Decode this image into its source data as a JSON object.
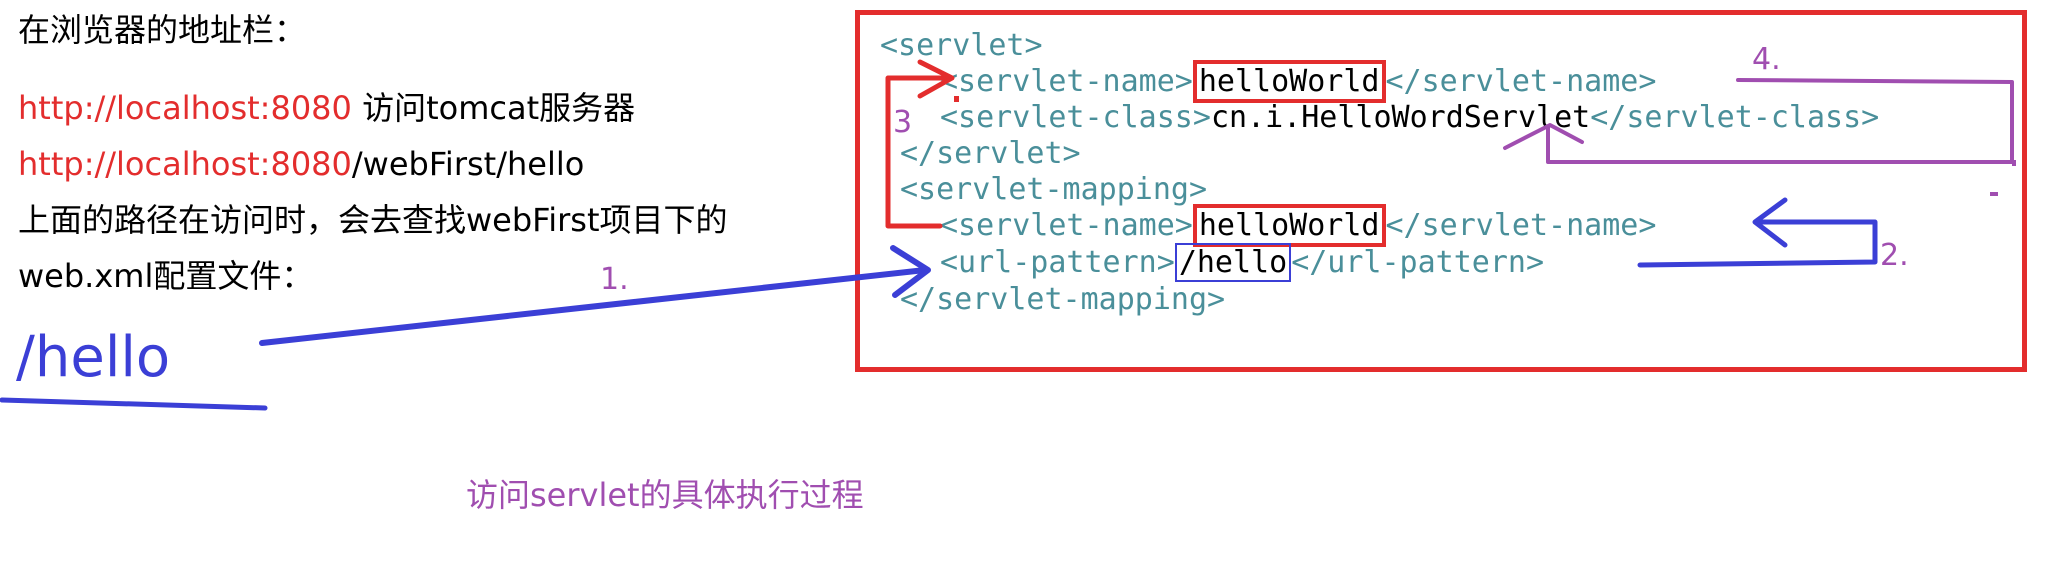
{
  "left": {
    "heading": "在浏览器的地址栏：",
    "line1_url": "http://localhost:8080",
    "line1_rest": " 访问tomcat服务器",
    "line2_url": "http://localhost:8080",
    "line2_rest": "/webFirst/hello",
    "line3": "上面的路径在访问时，会去查找webFirst项目下的",
    "line4": "web.xml配置文件：",
    "path": "/hello"
  },
  "caption": "访问servlet的具体执行过程",
  "code": {
    "l1": "<servlet>",
    "l2_open": "<servlet-name>",
    "l2_val": "helloWorld",
    "l2_close": "</servlet-name>",
    "l3_open": "<servlet-class>",
    "l3_val": "cn.i.HelloWordServlet",
    "l3_close": "</servlet-class>",
    "l4": "</servlet>",
    "l5": "<servlet-mapping>",
    "l6_open": "<servlet-name>",
    "l6_val": "helloWorld",
    "l6_close": "</servlet-name>",
    "l7_open": "<url-pattern>",
    "l7_val": "/hello",
    "l7_close": "</url-pattern>",
    "l8": "</servlet-mapping>"
  },
  "steps": {
    "s1": "1.",
    "s2": "2.",
    "s3": "3",
    "s4": "4."
  },
  "colors": {
    "red": "#e32d2d",
    "blue": "#3b3fd6",
    "purple": "#a04eb0",
    "tag": "#4a8f9a"
  }
}
